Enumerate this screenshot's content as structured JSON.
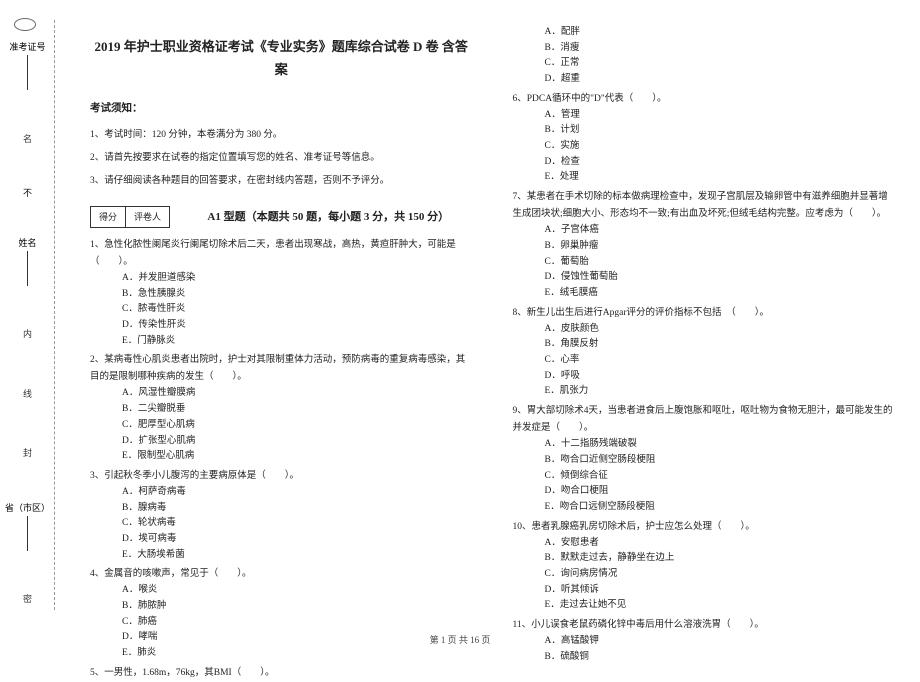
{
  "marginMarks": {
    "oval": "⌒",
    "labels": [
      "名",
      "内",
      "线",
      "封",
      "密"
    ],
    "fields": [
      {
        "label": "准考证号"
      },
      {
        "label": "不"
      },
      {
        "label": "姓名"
      },
      {
        "label": "省（市区）"
      }
    ]
  },
  "title": "2019 年护士职业资格证考试《专业实务》题库综合试卷 D 卷  含答案",
  "instructionsHeader": "考试须知：",
  "instructions": [
    "1、考试时间：120 分钟，本卷满分为 380 分。",
    "2、请首先按要求在试卷的指定位置填写您的姓名、准考证号等信息。",
    "3、请仔细阅读各种题目的回答要求，在密封线内答题，否则不予评分。"
  ],
  "scoreBox": {
    "left": "得分",
    "right": "评卷人"
  },
  "qTypeTitle": "A1 型题（本题共 50 题，每小题 3 分，共 150 分）",
  "col1": {
    "q1": {
      "text": "1、急性化脓性阑尾炎行阑尾切除术后二天，患者出现寒战，高热，黄疸肝肿大，可能是（　　）。",
      "opts": [
        "A．并发胆道感染",
        "B．急性胰腺炎",
        "C．脓毒性肝炎",
        "D．传染性肝炎",
        "E．门静脉炎"
      ]
    },
    "q2": {
      "text": "2、某病毒性心肌炎患者出院时，护士对其限制重体力活动，预防病毒的重复病毒感染，其目的是限制哪种疾病的发生（　　）。",
      "opts": [
        "A．风湿性瓣膜病",
        "B．二尖瓣脱垂",
        "C．肥厚型心肌病",
        "D．扩张型心肌病",
        "E．限制型心肌病"
      ]
    },
    "q3": {
      "text": "3、引起秋冬季小儿腹泻的主要病原体是（　　）。",
      "opts": [
        "A．柯萨奇病毒",
        "B．腺病毒",
        "C．轮状病毒",
        "D．埃可病毒",
        "E．大肠埃希菌"
      ]
    },
    "q4": {
      "text": "4、金属音的咳嗽声，常见于（　　）。",
      "opts": [
        "A．喉炎",
        "B．肺脓肿",
        "C．肺癌",
        "D．哮喘",
        "E．肺炎"
      ]
    },
    "q5": {
      "text": "5、一男性，1.68m，76kg，其BMI（　　）。"
    }
  },
  "col2": {
    "q5opts": [
      "A．配胖",
      "B．消瘦",
      "C．正常",
      "D．超重"
    ],
    "q6": {
      "text": "6、PDCA循环中的\"D\"代表（　　）。",
      "opts": [
        "A．管理",
        "B．计划",
        "C．实施",
        "D．检查",
        "E．处理"
      ]
    },
    "q7": {
      "text": "7、某患者在手术切除的标本做病理检查中，发现子宫肌层及输卵管中有滋养细胞并显著增生成团块状;细胞大小、形态均不一致;有出血及坏死;但绒毛结构完整。应考虑为（　　）。",
      "opts": [
        "A．子宫体癌",
        "B．卵巢肿瘤",
        "C．葡萄胎",
        "D．侵蚀性葡萄胎",
        "E．绒毛膜癌"
      ]
    },
    "q8": {
      "text": "8、新生儿出生后进行Apgar评分的评价指标不包括　（　　）。",
      "opts": [
        "A．皮肤颜色",
        "B．角膜反射",
        "C．心率",
        "D．呼吸",
        "E．肌张力"
      ]
    },
    "q9": {
      "text": "9、胃大部切除术4天，当患者进食后上腹饱胀和呕吐，呕吐物为食物无胆汁，最可能发生的并发症是（　　）。",
      "opts": [
        "A．十二指肠残端破裂",
        "B．吻合口近侧空肠段梗阻",
        "C．倾倒综合征",
        "D．吻合口梗阻",
        "E．吻合口远侧空肠段梗阻"
      ]
    },
    "q10": {
      "text": "10、患者乳腺癌乳房切除术后，护士应怎么处理（　　）。",
      "opts": [
        "A．安慰患者",
        "B．默默走过去，静静坐在边上",
        "C．询问病房情况",
        "D．听其倾诉",
        "E．走过去让她不见"
      ]
    },
    "q11": {
      "text": "11、小儿误食老鼠药磷化锌中毒后用什么溶液洗胃（　　）。",
      "opts": [
        "A．高锰酸钾",
        "B．硫酸铜"
      ]
    }
  },
  "footer": "第 1 页  共 16 页"
}
